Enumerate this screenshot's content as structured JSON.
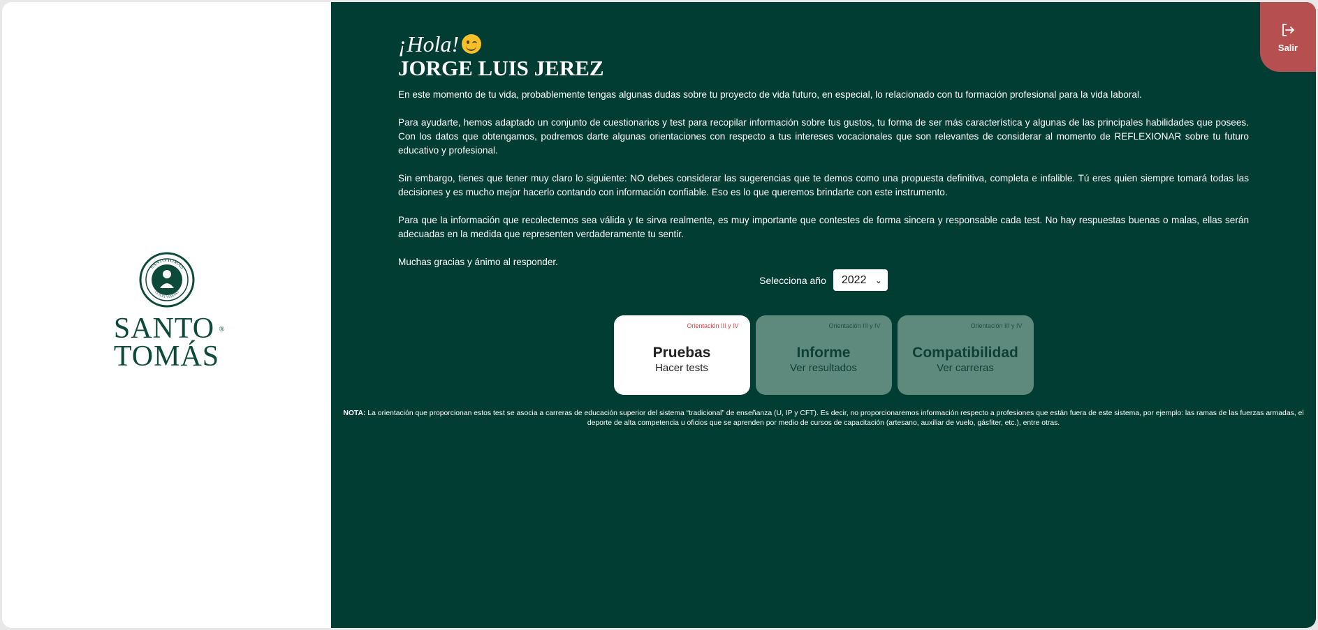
{
  "brand": {
    "seal_text_top": "SANTO TOMÁS",
    "seal_text_bottom": "LUX ET VERITAS",
    "name_line1": "SANTO",
    "name_line2": "TOMÁS",
    "reg": "®"
  },
  "logout": {
    "label": "Salir"
  },
  "greeting": {
    "hola": "¡Hola!",
    "user_name": "JORGE LUIS JEREZ"
  },
  "intro": {
    "p1": "En este momento de tu vida, probablemente tengas algunas dudas sobre tu proyecto de vida futuro, en especial, lo relacionado con tu formación profesional para la vida laboral.",
    "p2": "Para ayudarte, hemos adaptado un conjunto de cuestionarios y test para recopilar información sobre tus gustos, tu forma de ser más característica y algunas de las principales habilidades que posees. Con los datos que obtengamos, podremos darte algunas orientaciones con respecto a tus intereses vocacionales que son relevantes de considerar al momento de REFLEXIONAR sobre tu futuro educativo y profesional.",
    "p3": "Sin embargo, tienes que tener muy claro lo siguiente: NO debes considerar las sugerencias que te demos como una propuesta definitiva, completa e infalible. Tú eres quien siempre tomará todas las decisiones y es mucho mejor hacerlo contando con información confiable. Eso es lo que queremos brindarte con este instrumento.",
    "p4": "Para que la información que recolectemos sea válida y te sirva realmente, es muy importante que contestes de forma sincera y responsable cada test. No hay respuestas buenas o malas, ellas serán adecuadas en la medida que representen verdaderamente tu sentir.",
    "p5": "Muchas gracias y ánimo al responder."
  },
  "year": {
    "label": "Selecciona año",
    "selected": "2022"
  },
  "cards": [
    {
      "tag": "Orientación III y IV",
      "title": "Pruebas",
      "subtitle": "Hacer tests"
    },
    {
      "tag": "Orientación III y IV",
      "title": "Informe",
      "subtitle": "Ver resultados"
    },
    {
      "tag": "Orientación III y IV",
      "title": "Compatibilidad",
      "subtitle": "Ver carreras"
    }
  ],
  "note": {
    "label": "NOTA:",
    "text": "La orientación que proporcionan estos test se asocia a carreras de educación superior del sistema “tradicional” de enseñanza (U, IP y CFT). Es decir, no proporcionaremos información respecto a profesiones que están fuera de este sistema, por ejemplo: las ramas de las fuerzas armadas, el deporte de alta competencia u oficios que se aprenden por medio de cursos de capacitación (artesano, auxiliar de vuelo, gásfiter, etc.), entre otras."
  }
}
